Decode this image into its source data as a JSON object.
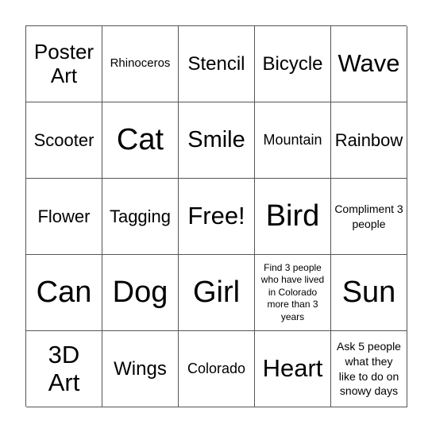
{
  "cells": [
    [
      "Poster Art",
      "Rhinoceros",
      "Stencil",
      "Bicycle",
      "Wave"
    ],
    [
      "Scooter",
      "Cat",
      "Smile",
      "Mountain",
      "Rainbow"
    ],
    [
      "Flower",
      "Tagging",
      "Free!",
      "Bird",
      "Compliment 3 people"
    ],
    [
      "Can",
      "Dog",
      "Girl",
      "Find 3 people who have lived in Colorado more than 3 years",
      "Sun"
    ],
    [
      "3D Art",
      "Wings",
      "Colorado",
      "Heart",
      "Ask 5 people what they like to do on snowy days"
    ]
  ]
}
